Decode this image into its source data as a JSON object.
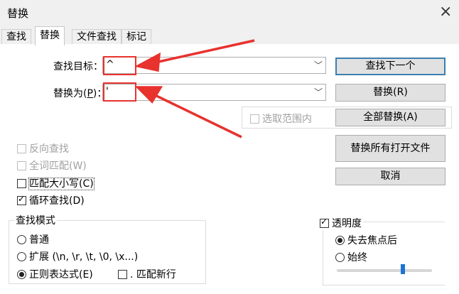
{
  "window": {
    "title": "替换",
    "close_glyph": "×"
  },
  "tabs": [
    {
      "label": "查找"
    },
    {
      "label": "替换"
    },
    {
      "label": "文件查找"
    },
    {
      "label": "标记"
    }
  ],
  "find": {
    "label": "查找目标：",
    "value": "^"
  },
  "replace": {
    "label_prefix": "替换为(",
    "label_key": "P",
    "label_suffix": ")：",
    "value": "'"
  },
  "buttons": {
    "find_next": "查找下一个",
    "replace": "替换(R)",
    "replace_all": "全部替换(A)",
    "replace_all_open": "替换所有打开文件",
    "cancel": "取消"
  },
  "in_selection": {
    "label": "选取范围内",
    "checked": false,
    "enabled": false
  },
  "options": {
    "backward": {
      "label": "反向查找",
      "checked": false,
      "enabled": false
    },
    "whole_word": {
      "label": "全词匹配(W)",
      "checked": false,
      "enabled": false
    },
    "match_case": {
      "label": "匹配大小写(C)",
      "checked": false,
      "enabled": true
    },
    "wrap": {
      "label": "循环查找(D)",
      "checked": true,
      "enabled": true
    }
  },
  "search_mode": {
    "title": "查找模式",
    "normal": "普通",
    "extended": "扩展 (\\n, \\r, \\t, \\0, \\x...)",
    "regex": "正则表达式(E)",
    "dot_newline": ". 匹配新行",
    "selected": "regex"
  },
  "transparency": {
    "label": "透明度",
    "checked": true,
    "on_lose_focus": "失去焦点后",
    "always": "始终",
    "selected": "on_lose_focus"
  },
  "colors": {
    "annotation": "#e8322e",
    "accent": "#3c7fb1"
  }
}
